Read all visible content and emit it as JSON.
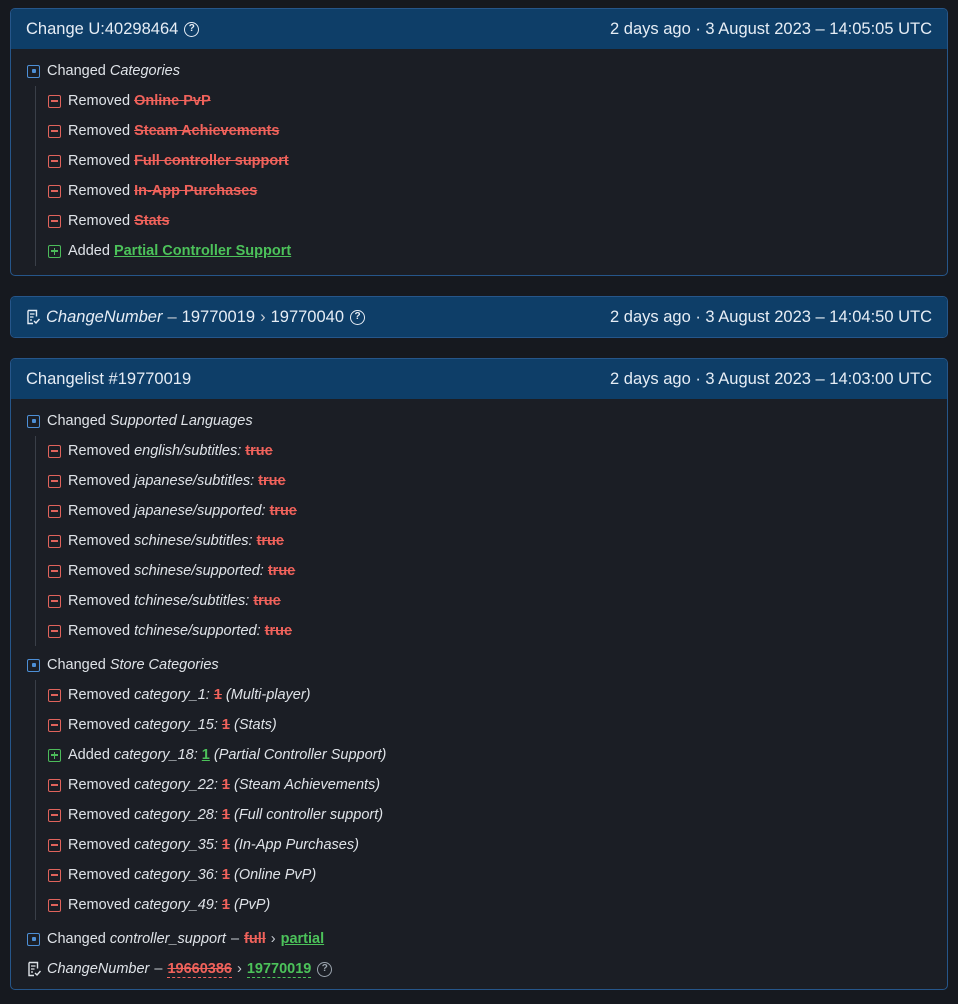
{
  "card1": {
    "title": "Change U:40298464",
    "time": "2 days ago · 3 August 2023 – 14:05:05 UTC",
    "changed_word": "Changed",
    "changed_field": "Categories",
    "items": [
      {
        "kind": "removed",
        "word": "Removed",
        "value": "Online PvP"
      },
      {
        "kind": "removed",
        "word": "Removed",
        "value": "Steam Achievements"
      },
      {
        "kind": "removed",
        "word": "Removed",
        "value": "Full controller support"
      },
      {
        "kind": "removed",
        "word": "Removed",
        "value": "In-App Purchases"
      },
      {
        "kind": "removed",
        "word": "Removed",
        "value": "Stats"
      },
      {
        "kind": "added",
        "word": "Added",
        "value": "Partial Controller Support"
      }
    ]
  },
  "card2": {
    "field": "ChangeNumber",
    "dash": "–",
    "from": "19770019",
    "arrow": "›",
    "to": "19770040",
    "time": "2 days ago · 3 August 2023 – 14:04:50 UTC"
  },
  "card3": {
    "title": "Changelist #19770019",
    "time": "2 days ago · 3 August 2023 – 14:03:00 UTC",
    "group1": {
      "changed_word": "Changed",
      "field": "Supported Languages",
      "items": [
        {
          "word": "Removed",
          "key": "english/subtitles:",
          "value": "true"
        },
        {
          "word": "Removed",
          "key": "japanese/subtitles:",
          "value": "true"
        },
        {
          "word": "Removed",
          "key": "japanese/supported:",
          "value": "true"
        },
        {
          "word": "Removed",
          "key": "schinese/subtitles:",
          "value": "true"
        },
        {
          "word": "Removed",
          "key": "schinese/supported:",
          "value": "true"
        },
        {
          "word": "Removed",
          "key": "tchinese/subtitles:",
          "value": "true"
        },
        {
          "word": "Removed",
          "key": "tchinese/supported:",
          "value": "true"
        }
      ]
    },
    "group2": {
      "changed_word": "Changed",
      "field": "Store Categories",
      "items": [
        {
          "kind": "removed",
          "word": "Removed",
          "key": "category_1:",
          "value": "1",
          "note": "(Multi-player)"
        },
        {
          "kind": "removed",
          "word": "Removed",
          "key": "category_15:",
          "value": "1",
          "note": "(Stats)"
        },
        {
          "kind": "added",
          "word": "Added",
          "key": "category_18:",
          "value": "1",
          "note": "(Partial Controller Support)"
        },
        {
          "kind": "removed",
          "word": "Removed",
          "key": "category_22:",
          "value": "1",
          "note": "(Steam Achievements)"
        },
        {
          "kind": "removed",
          "word": "Removed",
          "key": "category_28:",
          "value": "1",
          "note": "(Full controller support)"
        },
        {
          "kind": "removed",
          "word": "Removed",
          "key": "category_35:",
          "value": "1",
          "note": "(In-App Purchases)"
        },
        {
          "kind": "removed",
          "word": "Removed",
          "key": "category_36:",
          "value": "1",
          "note": "(Online PvP)"
        },
        {
          "kind": "removed",
          "word": "Removed",
          "key": "category_49:",
          "value": "1",
          "note": "(PvP)"
        }
      ]
    },
    "controller": {
      "changed_word": "Changed",
      "field": "controller_support",
      "dash": "–",
      "from": "full",
      "arrow": "›",
      "to": "partial"
    },
    "changenumber": {
      "field": "ChangeNumber",
      "dash": "–",
      "from": "19660386",
      "arrow": "›",
      "to": "19770019"
    }
  },
  "colors": {
    "header_bg": "#0e3e68",
    "removed": "#f0625b",
    "added": "#4cc25a",
    "changed": "#4d8fd6"
  },
  "icons": [
    "help-icon",
    "changed-icon",
    "removed-icon",
    "added-icon",
    "document-icon"
  ]
}
